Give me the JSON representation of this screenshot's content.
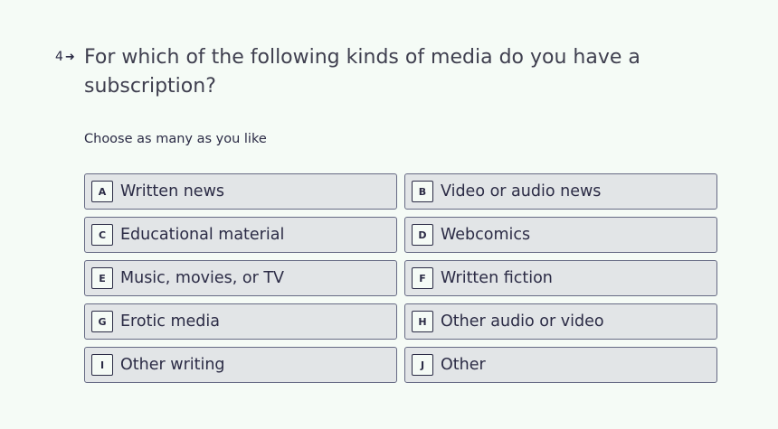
{
  "question": {
    "number": "4",
    "arrow": "➜",
    "title": "For which of the following kinds of media do you have a subscription?",
    "hint": "Choose as many as you like"
  },
  "options": [
    {
      "key": "A",
      "label": "Written news"
    },
    {
      "key": "B",
      "label": "Video or audio news"
    },
    {
      "key": "C",
      "label": "Educational material"
    },
    {
      "key": "D",
      "label": "Webcomics"
    },
    {
      "key": "E",
      "label": "Music, movies, or TV"
    },
    {
      "key": "F",
      "label": "Written fiction"
    },
    {
      "key": "G",
      "label": "Erotic media"
    },
    {
      "key": "H",
      "label": "Other audio or video"
    },
    {
      "key": "I",
      "label": "Other writing"
    },
    {
      "key": "J",
      "label": "Other"
    }
  ]
}
